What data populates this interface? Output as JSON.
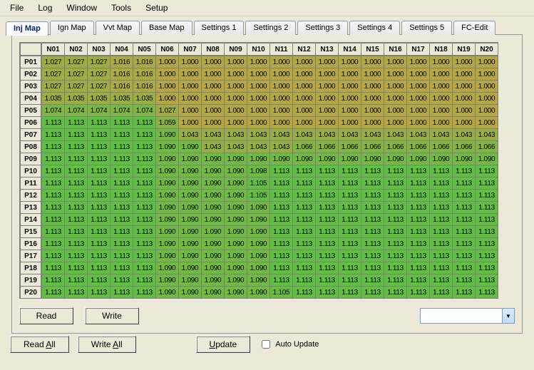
{
  "menu": [
    "File",
    "Log",
    "Window",
    "Tools",
    "Setup"
  ],
  "tabs": [
    "Inj Map",
    "Ign Map",
    "Vvt Map",
    "Base Map",
    "Settings 1",
    "Settings 2",
    "Settings 3",
    "Settings 4",
    "Settings 5",
    "FC-Edit"
  ],
  "buttons": {
    "read": "Read",
    "write": "Write",
    "read_all_pre": "Read ",
    "read_all_u": "A",
    "read_all_post": "ll",
    "write_all_pre": "Write ",
    "write_all_u": "A",
    "write_all_post": "ll",
    "update_u": "U",
    "update_post": "pdate",
    "auto_update": "Auto Update"
  },
  "dropdown": {
    "value": ""
  },
  "chart_data": {
    "type": "table",
    "title": "Inj Map",
    "col_headers": [
      "N01",
      "N02",
      "N03",
      "N04",
      "N05",
      "N06",
      "N07",
      "N08",
      "N09",
      "N10",
      "N11",
      "N12",
      "N13",
      "N14",
      "N15",
      "N16",
      "N17",
      "N18",
      "N19",
      "N20"
    ],
    "row_headers": [
      "P01",
      "P02",
      "P03",
      "P04",
      "P05",
      "P06",
      "P07",
      "P08",
      "P09",
      "P10",
      "P11",
      "P12",
      "P13",
      "P14",
      "P15",
      "P16",
      "P17",
      "P18",
      "P19",
      "P20"
    ],
    "rows": [
      [
        "1.027",
        "1.027",
        "1.027",
        "1.016",
        "1.016",
        "1.000",
        "1.000",
        "1.000",
        "1.000",
        "1.000",
        "1.000",
        "1.000",
        "1.000",
        "1.000",
        "1.000",
        "1.000",
        "1.000",
        "1.000",
        "1.000",
        "1.000"
      ],
      [
        "1.027",
        "1.027",
        "1.027",
        "1.016",
        "1.016",
        "1.000",
        "1.000",
        "1.000",
        "1.000",
        "1.000",
        "1.000",
        "1.000",
        "1.000",
        "1.000",
        "1.000",
        "1.000",
        "1.000",
        "1.000",
        "1.000",
        "1.000"
      ],
      [
        "1.027",
        "1.027",
        "1.027",
        "1.016",
        "1.016",
        "1.000",
        "1.000",
        "1.000",
        "1.000",
        "1.000",
        "1.000",
        "1.000",
        "1.000",
        "1.000",
        "1.000",
        "1.000",
        "1.000",
        "1.000",
        "1.000",
        "1.000"
      ],
      [
        "1.035",
        "1.035",
        "1.035",
        "1.035",
        "1.035",
        "1.000",
        "1.000",
        "1.000",
        "1.000",
        "1.000",
        "1.000",
        "1.000",
        "1.000",
        "1.000",
        "1.000",
        "1.000",
        "1.000",
        "1.000",
        "1.000",
        "1.000"
      ],
      [
        "1.074",
        "1.074",
        "1.074",
        "1.074",
        "1.074",
        "1.027",
        "1.000",
        "1.000",
        "1.000",
        "1.000",
        "1.000",
        "1.000",
        "1.000",
        "1.000",
        "1.000",
        "1.000",
        "1.000",
        "1.000",
        "1.000",
        "1.000"
      ],
      [
        "1.113",
        "1.113",
        "1.113",
        "1.113",
        "1.113",
        "1.059",
        "1.000",
        "1.000",
        "1.000",
        "1.000",
        "1.000",
        "1.000",
        "1.000",
        "1.000",
        "1.000",
        "1.000",
        "1.000",
        "1.000",
        "1.000",
        "1.000"
      ],
      [
        "1.113",
        "1.113",
        "1.113",
        "1.113",
        "1.113",
        "1.090",
        "1.043",
        "1.043",
        "1.043",
        "1.043",
        "1.043",
        "1.043",
        "1.043",
        "1.043",
        "1.043",
        "1.043",
        "1.043",
        "1.043",
        "1.043",
        "1.043"
      ],
      [
        "1.113",
        "1.113",
        "1.113",
        "1.113",
        "1.113",
        "1.090",
        "1.090",
        "1.043",
        "1.043",
        "1.043",
        "1.043",
        "1.066",
        "1.066",
        "1.066",
        "1.066",
        "1.066",
        "1.066",
        "1.066",
        "1.066",
        "1.066"
      ],
      [
        "1.113",
        "1.113",
        "1.113",
        "1.113",
        "1.113",
        "1.090",
        "1.090",
        "1.090",
        "1.090",
        "1.090",
        "1.090",
        "1.090",
        "1.090",
        "1.090",
        "1.090",
        "1.090",
        "1.090",
        "1.090",
        "1.090",
        "1.090"
      ],
      [
        "1.113",
        "1.113",
        "1.113",
        "1.113",
        "1.113",
        "1.090",
        "1.090",
        "1.090",
        "1.090",
        "1.098",
        "1.113",
        "1.113",
        "1.113",
        "1.113",
        "1.113",
        "1.113",
        "1.113",
        "1.113",
        "1.113",
        "1.113"
      ],
      [
        "1.113",
        "1.113",
        "1.113",
        "1.113",
        "1.113",
        "1.090",
        "1.090",
        "1.090",
        "1.090",
        "1.105",
        "1.113",
        "1.113",
        "1.113",
        "1.113",
        "1.113",
        "1.113",
        "1.113",
        "1.113",
        "1.113",
        "1.113"
      ],
      [
        "1.113",
        "1.113",
        "1.113",
        "1.113",
        "1.113",
        "1.090",
        "1.090",
        "1.090",
        "1.090",
        "1.105",
        "1.113",
        "1.113",
        "1.113",
        "1.113",
        "1.113",
        "1.113",
        "1.113",
        "1.113",
        "1.113",
        "1.113"
      ],
      [
        "1.113",
        "1.113",
        "1.113",
        "1.113",
        "1.113",
        "1.090",
        "1.090",
        "1.090",
        "1.090",
        "1.090",
        "1.113",
        "1.113",
        "1.113",
        "1.113",
        "1.113",
        "1.113",
        "1.113",
        "1.113",
        "1.113",
        "1.113"
      ],
      [
        "1.113",
        "1.113",
        "1.113",
        "1.113",
        "1.113",
        "1.090",
        "1.090",
        "1.090",
        "1.090",
        "1.090",
        "1.113",
        "1.113",
        "1.113",
        "1.113",
        "1.113",
        "1.113",
        "1.113",
        "1.113",
        "1.113",
        "1.113"
      ],
      [
        "1.113",
        "1.113",
        "1.113",
        "1.113",
        "1.113",
        "1.090",
        "1.090",
        "1.090",
        "1.090",
        "1.090",
        "1.113",
        "1.113",
        "1.113",
        "1.113",
        "1.113",
        "1.113",
        "1.113",
        "1.113",
        "1.113",
        "1.113"
      ],
      [
        "1.113",
        "1.113",
        "1.113",
        "1.113",
        "1.113",
        "1.090",
        "1.090",
        "1.090",
        "1.090",
        "1.090",
        "1.113",
        "1.113",
        "1.113",
        "1.113",
        "1.113",
        "1.113",
        "1.113",
        "1.113",
        "1.113",
        "1.113"
      ],
      [
        "1.113",
        "1.113",
        "1.113",
        "1.113",
        "1.113",
        "1.090",
        "1.090",
        "1.090",
        "1.090",
        "1.090",
        "1.113",
        "1.113",
        "1.113",
        "1.113",
        "1.113",
        "1.113",
        "1.113",
        "1.113",
        "1.113",
        "1.113"
      ],
      [
        "1.113",
        "1.113",
        "1.113",
        "1.113",
        "1.113",
        "1.090",
        "1.090",
        "1.090",
        "1.090",
        "1.090",
        "1.113",
        "1.113",
        "1.113",
        "1.113",
        "1.113",
        "1.113",
        "1.113",
        "1.113",
        "1.113",
        "1.113"
      ],
      [
        "1.113",
        "1.113",
        "1.113",
        "1.113",
        "1.113",
        "1.090",
        "1.090",
        "1.090",
        "1.090",
        "1.090",
        "1.113",
        "1.113",
        "1.113",
        "1.113",
        "1.113",
        "1.113",
        "1.113",
        "1.113",
        "1.113",
        "1.113"
      ],
      [
        "1.113",
        "1.113",
        "1.113",
        "1.113",
        "1.113",
        "1.090",
        "1.090",
        "1.090",
        "1.090",
        "1.090",
        "1.105",
        "1.113",
        "1.113",
        "1.113",
        "1.113",
        "1.113",
        "1.113",
        "1.113",
        "1.113",
        "1.113"
      ]
    ],
    "value_range": [
      1.0,
      1.113
    ]
  }
}
